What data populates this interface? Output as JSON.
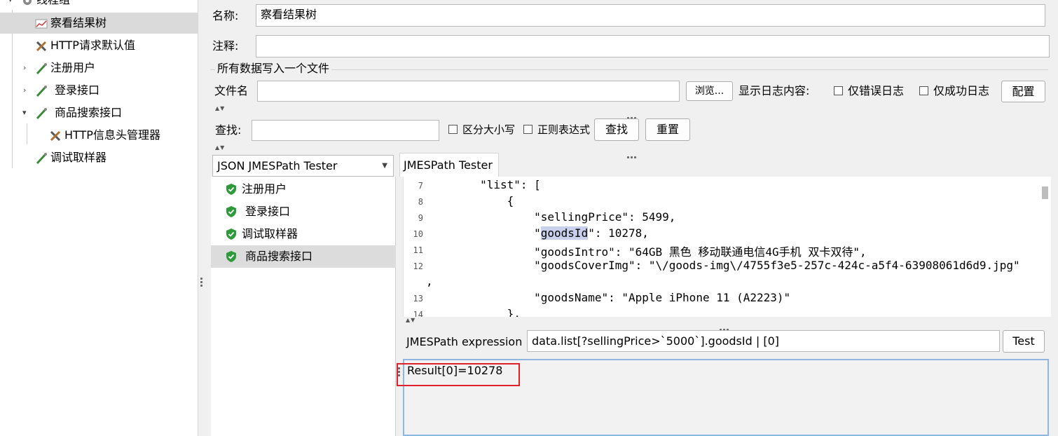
{
  "tree": {
    "items": [
      {
        "label": "线程组"
      },
      {
        "label": "察看结果树"
      },
      {
        "label": "HTTP请求默认值"
      },
      {
        "label": "注册用户"
      },
      {
        "label": "登录接口"
      },
      {
        "label": "商品搜索接口"
      },
      {
        "label": "HTTP信息头管理器"
      },
      {
        "label": "调试取样器"
      }
    ]
  },
  "form": {
    "name_label": "名称:",
    "name_value": "察看结果树",
    "comment_label": "注释:",
    "comment_value": "",
    "section_title": "所有数据写入一个文件",
    "filename_label": "文件名",
    "filename_value": "",
    "browse_button": "浏览...",
    "log_label": "显示日志内容:",
    "errors_only": "仅错误日志",
    "success_only": "仅成功日志",
    "config_button": "配置"
  },
  "search": {
    "label": "查找:",
    "value": "",
    "case_sensitive": "区分大小写",
    "regex": "正则表达式",
    "find_button": "查找",
    "reset_button": "重置"
  },
  "renderer": {
    "selected": "JSON JMESPath Tester"
  },
  "results": {
    "items": [
      {
        "label": "注册用户"
      },
      {
        "label": "登录接口"
      },
      {
        "label": "调试取样器"
      },
      {
        "label": "商品搜索接口"
      }
    ]
  },
  "tab": {
    "label": "JMESPath Tester"
  },
  "code": {
    "lines": [
      {
        "num": "7",
        "text": "        \"list\": ["
      },
      {
        "num": "8",
        "text": "            {"
      },
      {
        "num": "9",
        "text": "                \"sellingPrice\": 5499,"
      },
      {
        "num": "10",
        "pre": "                \"",
        "hl": "goodsId",
        "post": "\": 10278,"
      },
      {
        "num": "11",
        "text": "                \"goodsIntro\": \"64GB 黑色 移动联通电信4G手机 双卡双待\","
      },
      {
        "num": "12",
        "text": "                \"goodsCoverImg\": \"\\/goods-img\\/4755f3e5-257c-424c-a5f4-63908061d6d9.jpg\""
      },
      {
        "num": "",
        "text": ","
      },
      {
        "num": "13",
        "text": "                \"goodsName\": \"Apple iPhone 11 (A2223)\""
      },
      {
        "num": "14",
        "text": "            },"
      }
    ]
  },
  "jmes": {
    "label": "JMESPath expression",
    "value": "data.list[?sellingPrice>`5000`].goodsId | [0]",
    "test_button": "Test",
    "result": "Result[0]=10278"
  },
  "colors": {
    "highlight": "#c8d0ec",
    "annotation": "#e0202a",
    "shield": "#2e9b3a"
  }
}
